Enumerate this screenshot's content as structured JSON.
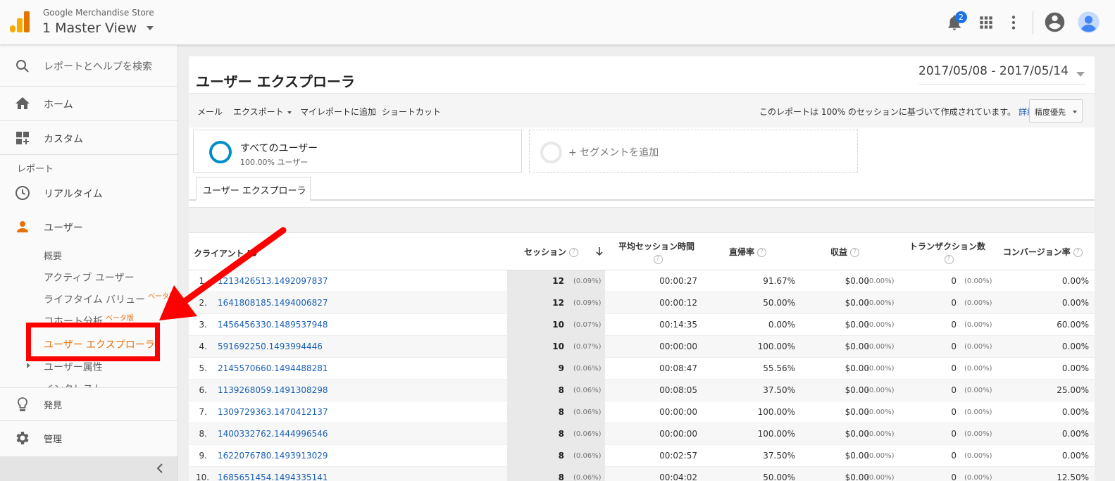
{
  "header": {
    "account_name": "Google Merchandise Store",
    "view_name": "1 Master View",
    "notification_count": "2"
  },
  "sidebar": {
    "search_label": "レポートとヘルプを検索",
    "home_label": "ホーム",
    "custom_label": "カスタム",
    "reports_heading": "レポート",
    "realtime_label": "リアルタイム",
    "users_label": "ユーザー",
    "sub_items": [
      {
        "label": "概要"
      },
      {
        "label": "アクティブ ユーザー"
      },
      {
        "label": "ライフタイム バリュー",
        "badge": "ベータ版"
      },
      {
        "label": "コホート分析",
        "badge": "ベータ版"
      },
      {
        "label": "ユーザー エクスプローラ"
      },
      {
        "label": "ユーザー属性"
      },
      {
        "label": "インタレスト"
      }
    ],
    "discover_label": "発見",
    "admin_label": "管理"
  },
  "report": {
    "title": "ユーザー エクスプローラ",
    "date_range": "2017/05/08 - 2017/05/14"
  },
  "toolbar": {
    "mail": "メール",
    "export": "エクスポート",
    "add_to_dashboard": "マイレポートに追加",
    "shortcut": "ショートカット",
    "sampling_note": "このレポートは 100% のセッションに基づいて作成されています。",
    "details_link": "詳細",
    "precision": "精度優先"
  },
  "segments": {
    "all_users_name": "すべてのユーザー",
    "all_users_pct": "100.00% ユーザー",
    "add_segment": "+ セグメントを追加"
  },
  "tab_label": "ユーザー エクスプローラ",
  "table": {
    "columns": {
      "client_id": "クライアント ID",
      "sessions": "セッション",
      "avg_duration": "平均セッション時間",
      "bounce": "直帰率",
      "revenue": "収益",
      "transactions": "トランザクション数",
      "conversion": "コンバージョン率"
    },
    "rows": [
      {
        "idx": "1.",
        "client_id": "1213426513.1492097837",
        "sessions": "12",
        "sessions_pct": "(0.09%)",
        "duration": "00:00:27",
        "bounce": "91.67%",
        "revenue": "$0.00",
        "revenue_pct": "(0.00%)",
        "transactions": "0",
        "transactions_pct": "(0.00%)",
        "conversion": "0.00%"
      },
      {
        "idx": "2.",
        "client_id": "1641808185.1494006827",
        "sessions": "12",
        "sessions_pct": "(0.09%)",
        "duration": "00:00:12",
        "bounce": "50.00%",
        "revenue": "$0.00",
        "revenue_pct": "(0.00%)",
        "transactions": "0",
        "transactions_pct": "(0.00%)",
        "conversion": "0.00%"
      },
      {
        "idx": "3.",
        "client_id": "1456456330.1489537948",
        "sessions": "10",
        "sessions_pct": "(0.07%)",
        "duration": "00:14:35",
        "bounce": "0.00%",
        "revenue": "$0.00",
        "revenue_pct": "(0.00%)",
        "transactions": "0",
        "transactions_pct": "(0.00%)",
        "conversion": "60.00%"
      },
      {
        "idx": "4.",
        "client_id": "591692250.1493994446",
        "sessions": "10",
        "sessions_pct": "(0.07%)",
        "duration": "00:00:00",
        "bounce": "100.00%",
        "revenue": "$0.00",
        "revenue_pct": "(0.00%)",
        "transactions": "0",
        "transactions_pct": "(0.00%)",
        "conversion": "0.00%"
      },
      {
        "idx": "5.",
        "client_id": "2145570660.1494488281",
        "sessions": "9",
        "sessions_pct": "(0.06%)",
        "duration": "00:08:47",
        "bounce": "55.56%",
        "revenue": "$0.00",
        "revenue_pct": "(0.00%)",
        "transactions": "0",
        "transactions_pct": "(0.00%)",
        "conversion": "0.00%"
      },
      {
        "idx": "6.",
        "client_id": "1139268059.1491308298",
        "sessions": "8",
        "sessions_pct": "(0.06%)",
        "duration": "00:08:05",
        "bounce": "37.50%",
        "revenue": "$0.00",
        "revenue_pct": "(0.00%)",
        "transactions": "0",
        "transactions_pct": "(0.00%)",
        "conversion": "25.00%"
      },
      {
        "idx": "7.",
        "client_id": "1309729363.1470412137",
        "sessions": "8",
        "sessions_pct": "(0.06%)",
        "duration": "00:00:00",
        "bounce": "100.00%",
        "revenue": "$0.00",
        "revenue_pct": "(0.00%)",
        "transactions": "0",
        "transactions_pct": "(0.00%)",
        "conversion": "0.00%"
      },
      {
        "idx": "8.",
        "client_id": "1400332762.1444996546",
        "sessions": "8",
        "sessions_pct": "(0.06%)",
        "duration": "00:00:00",
        "bounce": "100.00%",
        "revenue": "$0.00",
        "revenue_pct": "(0.00%)",
        "transactions": "0",
        "transactions_pct": "(0.00%)",
        "conversion": "0.00%"
      },
      {
        "idx": "9.",
        "client_id": "1622076780.1493913029",
        "sessions": "8",
        "sessions_pct": "(0.06%)",
        "duration": "00:02:57",
        "bounce": "37.50%",
        "revenue": "$0.00",
        "revenue_pct": "(0.00%)",
        "transactions": "0",
        "transactions_pct": "(0.00%)",
        "conversion": "0.00%"
      },
      {
        "idx": "10.",
        "client_id": "1685651454.1494335141",
        "sessions": "8",
        "sessions_pct": "(0.06%)",
        "duration": "00:04:02",
        "bounce": "50.00%",
        "revenue": "$0.00",
        "revenue_pct": "(0.00%)",
        "transactions": "0",
        "transactions_pct": "(0.00%)",
        "conversion": "12.50%"
      }
    ]
  },
  "colors": {
    "accent_orange": "#e8710a",
    "link_blue": "#1a5fb4",
    "annotation_red": "#ff0000",
    "segment_blue": "#058dc7"
  }
}
